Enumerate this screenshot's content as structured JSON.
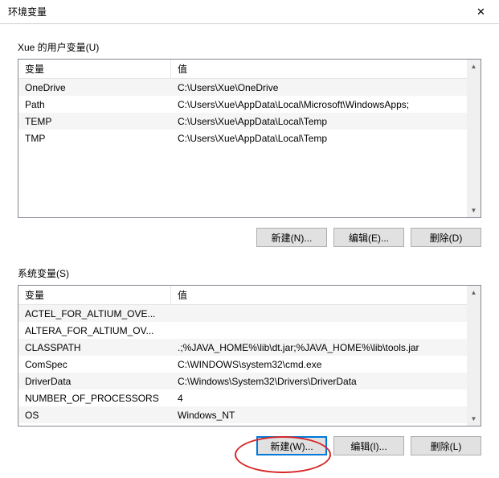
{
  "window": {
    "title": "环境变量",
    "close_symbol": "✕"
  },
  "user_section": {
    "label": "Xue 的用户变量(U)",
    "columns": {
      "var": "变量",
      "val": "值"
    },
    "rows": [
      {
        "var": "OneDrive",
        "val": "C:\\Users\\Xue\\OneDrive"
      },
      {
        "var": "Path",
        "val": "C:\\Users\\Xue\\AppData\\Local\\Microsoft\\WindowsApps;"
      },
      {
        "var": "TEMP",
        "val": "C:\\Users\\Xue\\AppData\\Local\\Temp"
      },
      {
        "var": "TMP",
        "val": "C:\\Users\\Xue\\AppData\\Local\\Temp"
      }
    ],
    "buttons": {
      "new": "新建(N)...",
      "edit": "编辑(E)...",
      "delete": "删除(D)"
    }
  },
  "system_section": {
    "label": "系统变量(S)",
    "columns": {
      "var": "变量",
      "val": "值"
    },
    "rows": [
      {
        "var": "ACTEL_FOR_ALTIUM_OVE...",
        "val": ""
      },
      {
        "var": "ALTERA_FOR_ALTIUM_OV...",
        "val": ""
      },
      {
        "var": "CLASSPATH",
        "val": ".;%JAVA_HOME%\\lib\\dt.jar;%JAVA_HOME%\\lib\\tools.jar"
      },
      {
        "var": "ComSpec",
        "val": "C:\\WINDOWS\\system32\\cmd.exe"
      },
      {
        "var": "DriverData",
        "val": "C:\\Windows\\System32\\Drivers\\DriverData"
      },
      {
        "var": "NUMBER_OF_PROCESSORS",
        "val": "4"
      },
      {
        "var": "OS",
        "val": "Windows_NT"
      }
    ],
    "buttons": {
      "new": "新建(W)...",
      "edit": "编辑(I)...",
      "delete": "删除(L)"
    }
  },
  "scroll": {
    "up": "▲",
    "down": "▼"
  }
}
